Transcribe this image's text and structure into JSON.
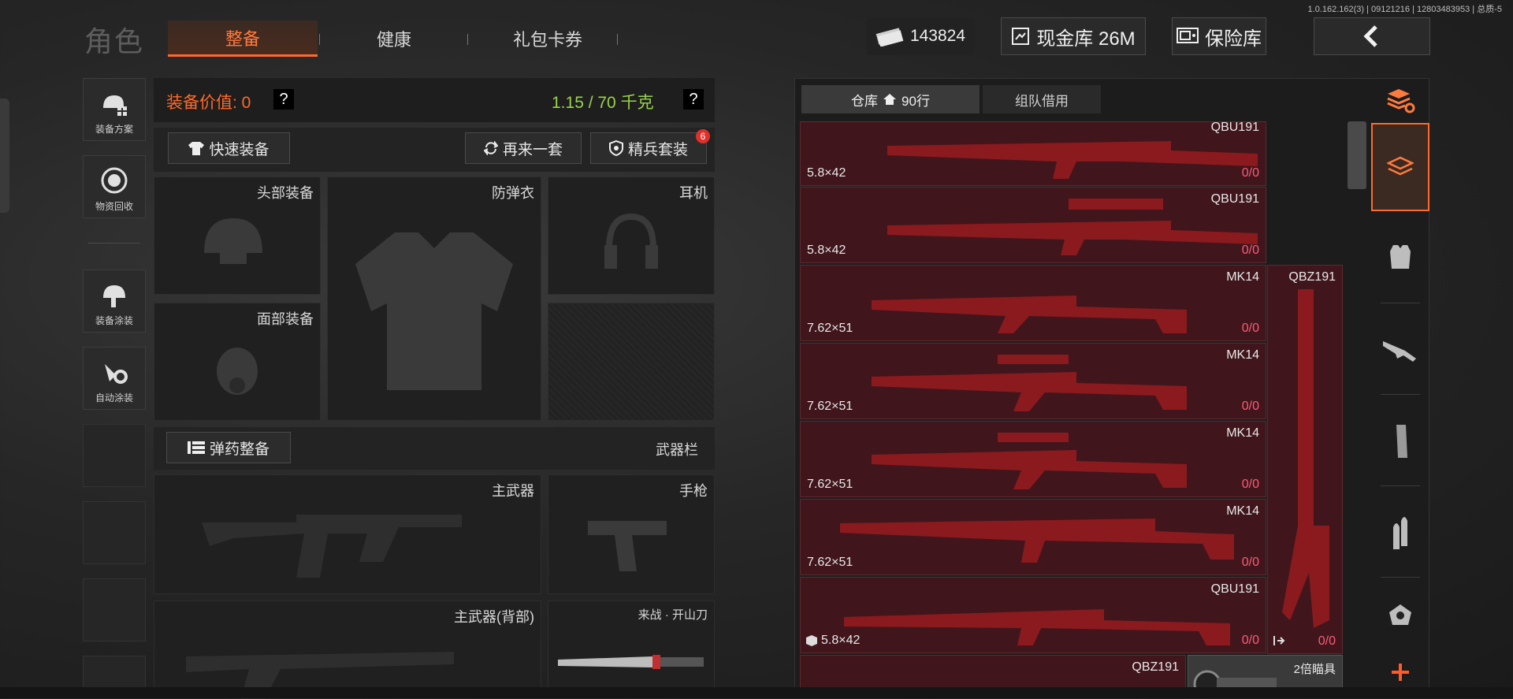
{
  "version": "1.0.162.162(3) | 09121216 | 12803483953 | 总质-5",
  "title": "角色",
  "tabs": [
    {
      "label": "整备",
      "active": true
    },
    {
      "label": "健康",
      "active": false
    },
    {
      "label": "礼包卡券",
      "active": false
    }
  ],
  "top": {
    "currency": "143824",
    "cash_vault": "现金库 26M",
    "safe": "保险库"
  },
  "left_menu": [
    {
      "label": "装备方案",
      "icon": "loadout-icon"
    },
    {
      "label": "物资回收",
      "icon": "recycle-icon"
    },
    {
      "label": "装备涂装",
      "icon": "paint-helmet-icon"
    },
    {
      "label": "自动涂装",
      "icon": "auto-paint-icon"
    }
  ],
  "equip": {
    "value_label": "装备价值: 0",
    "weight": "1.15 / 70 千克",
    "help": "?",
    "quick_equip": "快速装备",
    "again": "再来一套",
    "elite_set": "精兵套装",
    "elite_badge": "6",
    "slots": {
      "head": "头部装备",
      "armor": "防弹衣",
      "headset": "耳机",
      "face": "面部装备"
    },
    "ammo_btn": "弹药整备",
    "weapon_bar": "武器栏",
    "primary": "主武器",
    "pistol": "手枪",
    "primary_back": "主武器(背部)",
    "melee": "来战 · 开山刀"
  },
  "storage": {
    "tab_warehouse": "仓库",
    "rows": "90行",
    "tab_team": "组队借用",
    "items": [
      {
        "name": "QBU191",
        "caliber": "5.8×42",
        "count": "0/0"
      },
      {
        "name": "QBU191",
        "caliber": "5.8×42",
        "count": "0/0"
      },
      {
        "name": "MK14",
        "caliber": "7.62×51",
        "count": "0/0"
      },
      {
        "name": "MK14",
        "caliber": "7.62×51",
        "count": "0/0"
      },
      {
        "name": "MK14",
        "caliber": "7.62×51",
        "count": "0/0"
      },
      {
        "name": "MK14",
        "caliber": "7.62×51",
        "count": "0/0"
      },
      {
        "name": "QBU191",
        "caliber": "5.8×42",
        "count": "0/0"
      }
    ],
    "tall_item": {
      "name": "QBZ191",
      "count": "0/0"
    },
    "bottom_item": "QBZ191",
    "scope_item": "2倍瞄具"
  }
}
